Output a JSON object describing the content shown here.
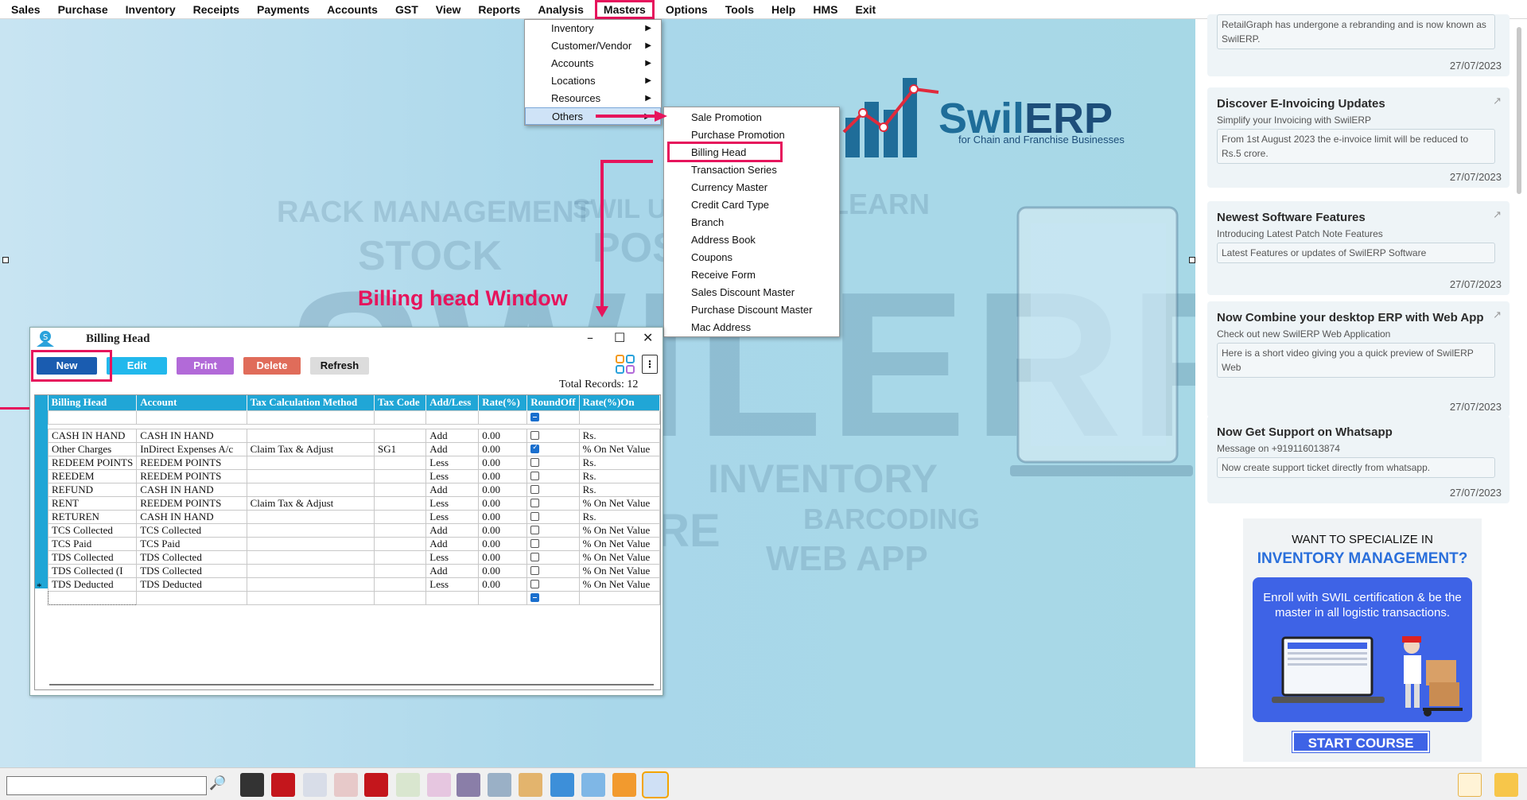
{
  "menubar": [
    "Sales",
    "Purchase",
    "Inventory",
    "Receipts",
    "Payments",
    "Accounts",
    "GST",
    "View",
    "Reports",
    "Analysis",
    "Masters",
    "Options",
    "Tools",
    "Help",
    "HMS",
    "Exit"
  ],
  "masters_menu": [
    {
      "label": "Inventory",
      "arrow": "▶"
    },
    {
      "label": "Customer/Vendor",
      "arrow": "▶"
    },
    {
      "label": "Accounts",
      "arrow": "▶"
    },
    {
      "label": "Locations",
      "arrow": "▶"
    },
    {
      "label": "Resources",
      "arrow": "▶"
    },
    {
      "label": "Others",
      "arrow": "▶"
    }
  ],
  "others_menu": [
    "Sale Promotion",
    "Purchase Promotion",
    "Billing Head",
    "Transaction Series",
    "Currency Master",
    "Credit Card Type",
    "Branch",
    "Address Book",
    "Coupons",
    "Receive Form",
    "Sales Discount Master",
    "Purchase Discount Master",
    "Mac Address"
  ],
  "logo": {
    "brand_a": "Swil",
    "brand_b": "ERP",
    "tagline": "for Chain and Franchise Businesses"
  },
  "background_words": [
    "RACK MANAGEMENT",
    "STOCK",
    "SWIL U",
    "POS",
    "LEARN",
    "INVENTORY",
    "BARCODING",
    "WEB APP",
    "ORE",
    "SWILERP"
  ],
  "annotation": "Billing head Window",
  "window": {
    "title": "Billing Head",
    "buttons": {
      "new": "New",
      "edit": "Edit",
      "print": "Print",
      "delete": "Delete",
      "refresh": "Refresh"
    },
    "more": "⋮",
    "total": "Total Records: 12",
    "columns": [
      "Billing Head",
      "Account",
      "Tax Calculation Method",
      "Tax Code",
      "Add/Less",
      "Rate(%)",
      "RoundOff",
      "Rate(%)On"
    ],
    "rows": [
      [
        "CASH IN HAND",
        "CASH IN HAND",
        "",
        "",
        "Add",
        "0.00",
        false,
        "Rs."
      ],
      [
        "Other Charges",
        "InDirect Expenses A/c",
        "Claim Tax & Adjust",
        "SG1",
        "Add",
        "0.00",
        true,
        "% On Net Value"
      ],
      [
        "REDEEM POINTS",
        "REEDEM POINTS",
        "",
        "",
        "Less",
        "0.00",
        false,
        "Rs."
      ],
      [
        "REEDEM",
        "REEDEM POINTS",
        "",
        "",
        "Less",
        "0.00",
        false,
        "Rs."
      ],
      [
        "REFUND",
        "CASH IN HAND",
        "",
        "",
        "Add",
        "0.00",
        false,
        "Rs."
      ],
      [
        "RENT",
        "REEDEM POINTS",
        "Claim Tax & Adjust",
        "",
        "Less",
        "0.00",
        false,
        "% On Net Value"
      ],
      [
        "RETUREN",
        "CASH IN HAND",
        "",
        "",
        "Less",
        "0.00",
        false,
        "Rs."
      ],
      [
        "TCS Collected",
        "TCS Collected",
        "",
        "",
        "Add",
        "0.00",
        false,
        "% On Net Value"
      ],
      [
        "TCS Paid",
        "TCS Paid",
        "",
        "",
        "Add",
        "0.00",
        false,
        "% On Net Value"
      ],
      [
        "TDS Collected",
        "TDS Collected",
        "",
        "",
        "Less",
        "0.00",
        false,
        "% On Net Value"
      ],
      [
        "TDS Collected (I",
        "TDS Collected",
        "",
        "",
        "Add",
        "0.00",
        false,
        "% On Net Value"
      ],
      [
        "TDS Deducted",
        "TDS Deducted",
        "",
        "",
        "Less",
        "0.00",
        false,
        "% On Net Value"
      ]
    ],
    "new_row_marker": "*"
  },
  "news": [
    {
      "title": "",
      "subtitle": "",
      "body": "RetailGraph has undergone a rebranding and is now known as SwilERP.",
      "date": "27/07/2023"
    },
    {
      "title": "Discover E-Invoicing Updates",
      "subtitle": "Simplify your Invoicing with SwilERP",
      "body": "From 1st August 2023 the e-invoice limit will be reduced to Rs.5 crore.",
      "date": "27/07/2023"
    },
    {
      "title": "Newest Software Features",
      "subtitle": "Introducing Latest Patch Note Features",
      "body": "Latest Features or updates of SwilERP Software",
      "date": "27/07/2023"
    },
    {
      "title": "Now Combine your desktop ERP with Web App",
      "subtitle": "Check out new SwilERP Web Application",
      "body": "Here is a short video giving you a quick preview of SwilERP Web",
      "date": "27/07/2023"
    },
    {
      "title": "Now Get Support on Whatsapp",
      "subtitle": "Message on +919116013874",
      "body": "Now create support ticket directly from whatsapp.",
      "date": "27/07/2023"
    }
  ],
  "promo": {
    "line1": "WANT TO SPECIALIZE IN",
    "line2": "INVENTORY MANAGEMENT?",
    "line3": "Enroll with SWIL certification & be the master in all logistic transactions.",
    "cta": "START COURSE"
  },
  "taskbar": {
    "search_value": "",
    "search_icon": "🔎"
  },
  "colors": {
    "highlight": "#e6145c",
    "grid_header": "#20a6d6",
    "brand": "#1f6d99",
    "promo": "#3e63e6"
  }
}
